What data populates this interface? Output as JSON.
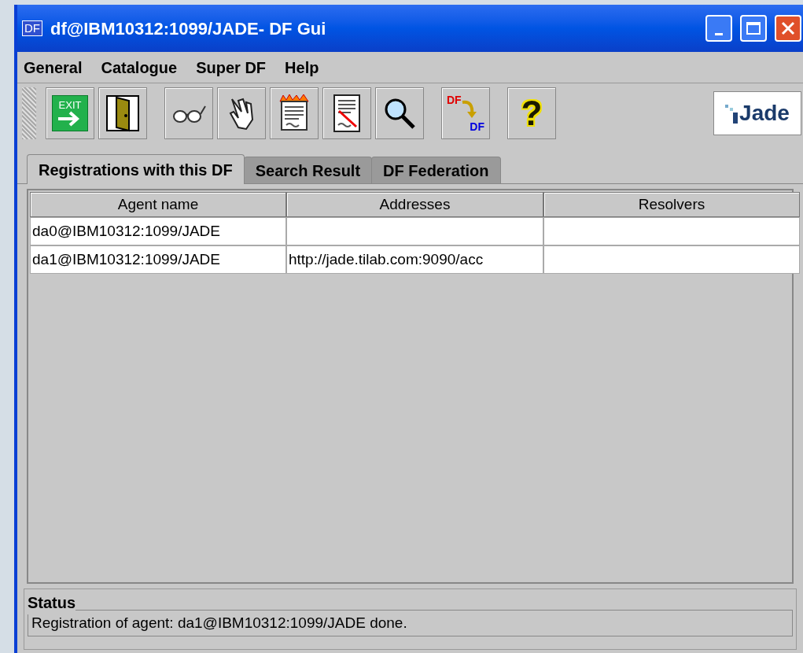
{
  "window": {
    "title": "df@IBM10312:1099/JADE- DF Gui",
    "icon_text": "DF"
  },
  "menu": [
    "General",
    "Catalogue",
    "Super DF",
    "Help"
  ],
  "toolbar": [
    {
      "kind": "exit",
      "label": "EXIT"
    },
    {
      "kind": "door"
    },
    {
      "kind": "glasses"
    },
    {
      "kind": "hand"
    },
    {
      "kind": "fire"
    },
    {
      "kind": "document"
    },
    {
      "kind": "search"
    },
    {
      "kind": "federate",
      "label": "DF",
      "label2": "DF"
    },
    {
      "kind": "help",
      "label": "?"
    }
  ],
  "logo": {
    "text": "Jade"
  },
  "tabs": [
    {
      "label": "Registrations with this DF",
      "selected": true
    },
    {
      "label": "Search Result",
      "selected": false
    },
    {
      "label": "DF Federation",
      "selected": false
    }
  ],
  "table": {
    "columns": [
      "Agent name",
      "Addresses",
      "Resolvers"
    ],
    "rows": [
      [
        "da0@IBM10312:1099/JADE",
        "",
        ""
      ],
      [
        "da1@IBM10312:1099/JADE",
        "http://jade.tilab.com:9090/acc",
        ""
      ]
    ]
  },
  "status": {
    "title": "Status",
    "message": "Registration of agent: da1@IBM10312:1099/JADE done."
  }
}
